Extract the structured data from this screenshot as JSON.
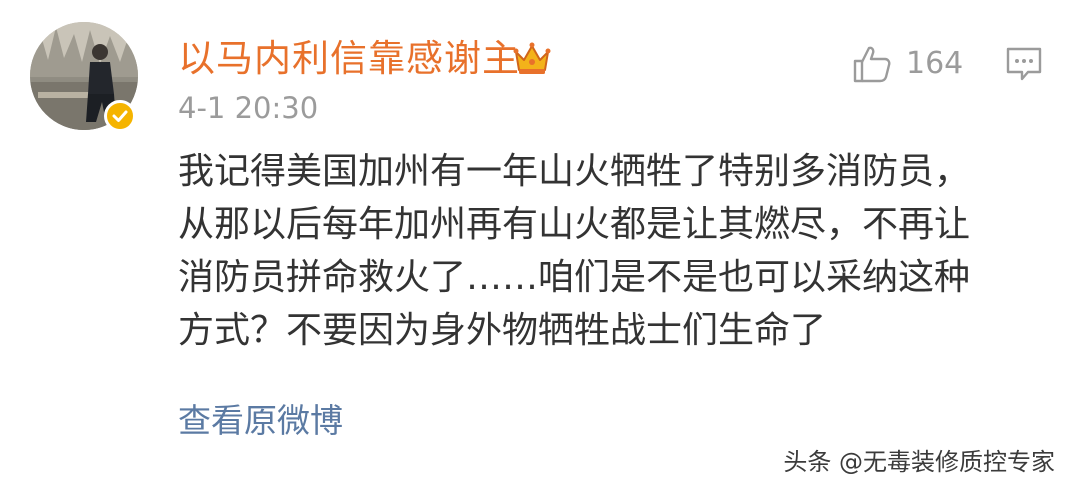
{
  "comment": {
    "username": "以马内利信靠感谢主",
    "timestamp": "4-1 20:30",
    "like_count": "164",
    "body_lines": [
      "我记得美国加州有一年山火牺牲了特别多消防员，",
      "从那以后每年加州再有山火都是让其燃尽，不再让",
      "消防员拼命救火了……咱们是不是也可以采纳这种",
      "方式？不要因为身外物牺牲战士们生命了"
    ],
    "view_original_label": "查看原微博"
  },
  "watermark": {
    "text": "头条 @无毒装修质控专家"
  },
  "icons": {
    "avatar": "avatar-photo",
    "verified": "verified-badge-icon",
    "crown": "crown-badge-icon",
    "like": "thumbs-up-icon",
    "reply": "comment-bubble-icon"
  },
  "colors": {
    "username": "#e8712b",
    "meta": "#9b9b9b",
    "body": "#333333",
    "link": "#5b7aa3",
    "verified": "#f5b400"
  }
}
